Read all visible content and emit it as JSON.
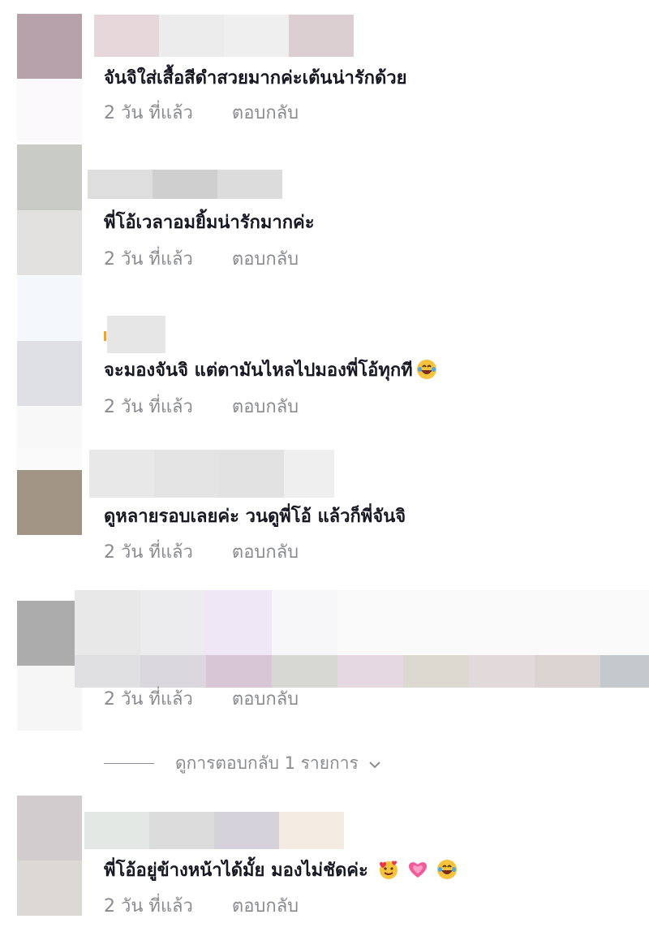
{
  "comments": [
    {
      "text": "จันจิใส่เสื้อสีดำสวยมากค่ะเต้นน่ารักด้วย",
      "time": "2 วัน ที่แล้ว",
      "reply": "ตอบกลับ",
      "avatar_colors": [
        "#b7a1ab",
        "#fcf9fc"
      ],
      "name_colors": [
        "#e6d8da",
        "#ececec",
        "#efefef",
        "#dccfd2"
      ]
    },
    {
      "text": "พี่โอ้เวลาอมยิ้มน่ารักมากค่ะ",
      "time": "2 วัน ที่แล้ว",
      "reply": "ตอบกลับ",
      "avatar_colors": [
        "#c8ccc4",
        "#e3e0e0"
      ],
      "name_colors": [
        "#dedede",
        "#cfcfcf",
        "#dcdcdc"
      ]
    },
    {
      "text": "จะมองจันจิ แต่ตามันไหลไปมองพี่โอ้ทุกที",
      "emojis": [
        "laugh-emoji"
      ],
      "time": "2 วัน ที่แล้ว",
      "reply": "ตอบกลับ",
      "avatar_colors": [
        "#f4f7fc",
        "#dfe0e6",
        "#f8f8f8"
      ],
      "name_colors": [
        "#e6e6e6"
      ]
    },
    {
      "text": "ดูหลายรอบเลยค่ะ วนดูพี่โอ้ แล้วก็พี่จันจิ",
      "time": "2 วัน ที่แล้ว",
      "reply": "ตอบกลับ",
      "avatar_colors": [
        "#fafafa",
        "#a09584"
      ],
      "name_colors": [
        "#e8e8e8",
        "#e4e4e4",
        "#e2e2e2",
        "#efefef"
      ]
    },
    {
      "time": "2 วัน ที่แล้ว",
      "reply": "ตอบกลับ",
      "avatar_colors": [
        "#acacac",
        "#f6f6f6"
      ],
      "mosaic_rows": [
        [
          "#e8e8e8",
          "#ececee",
          "#efe7f5",
          "#f7f7f9",
          "#fafafa",
          "#fafafa",
          "#fafafa",
          "#fafafa",
          "#fafafa"
        ],
        [
          "#e0e0e2",
          "#dad8de",
          "#d8c6d6",
          "#d8d8d2",
          "#e6d8e0",
          "#dcdad0",
          "#e2dada",
          "#dcd4d2",
          "#c3c9cd"
        ]
      ]
    },
    {
      "text": "พี่โอ้อยู่ข้างหน้าได้มั้ย มองไม่ชัดค่ะ",
      "emojis": [
        "love-emoji",
        "pink-heart-emoji",
        "laugh-emoji"
      ],
      "time": "2 วัน ที่แล้ว",
      "reply": "ตอบกลับ",
      "avatar_colors": [
        "#d2ccce",
        "#dcd8d4"
      ],
      "name_colors": [
        "#e4e8e4",
        "#dcdcdc",
        "#d6d2dc",
        "#f4ebe2"
      ]
    }
  ],
  "view_replies": {
    "label": "ดูการตอบกลับ 1 รายการ",
    "icon": "chevron-down-icon"
  }
}
